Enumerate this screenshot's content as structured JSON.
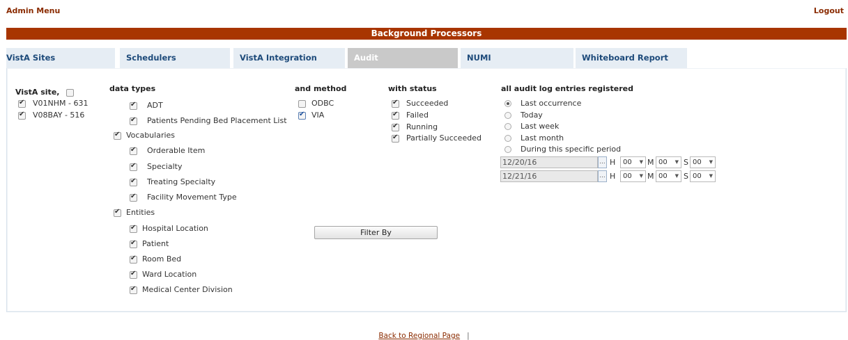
{
  "header": {
    "admin_menu": "Admin Menu",
    "logout": "Logout"
  },
  "title": "Background Processors",
  "tabs": [
    {
      "label": "VistA Sites"
    },
    {
      "label": "Schedulers"
    },
    {
      "label": "VistA Integration"
    },
    {
      "label": "Audit",
      "active": true
    },
    {
      "label": "NUMI"
    },
    {
      "label": "Whiteboard Report"
    }
  ],
  "sites": {
    "heading": "VistA site,",
    "all_checked": false,
    "items": [
      {
        "label": "V01NHM - 631",
        "checked": true
      },
      {
        "label": "V08BAY - 516",
        "checked": true
      }
    ]
  },
  "data_types": {
    "heading": "data types",
    "adt": {
      "label": "ADT",
      "checked": true
    },
    "pending": {
      "label": "Patients Pending Bed Placement List",
      "checked": true
    },
    "vocabularies": {
      "label": "Vocabularies",
      "checked": true,
      "items": [
        {
          "label": "Orderable Item",
          "checked": true
        },
        {
          "label": "Specialty",
          "checked": true
        },
        {
          "label": "Treating Specialty",
          "checked": true
        },
        {
          "label": "Facility Movement Type",
          "checked": true
        }
      ]
    },
    "entities": {
      "label": "Entities",
      "checked": true,
      "items": [
        {
          "label": "Hospital Location",
          "checked": true
        },
        {
          "label": "Patient",
          "checked": true
        },
        {
          "label": "Room Bed",
          "checked": true
        },
        {
          "label": "Ward Location",
          "checked": true
        },
        {
          "label": "Medical Center Division",
          "checked": true
        }
      ]
    }
  },
  "method": {
    "heading": "and method",
    "items": [
      {
        "label": "ODBC",
        "checked": false
      },
      {
        "label": "VIA",
        "checked": true
      }
    ]
  },
  "status": {
    "heading": "with status",
    "items": [
      {
        "label": "Succeeded",
        "checked": true
      },
      {
        "label": "Failed",
        "checked": true
      },
      {
        "label": "Running",
        "checked": true
      },
      {
        "label": "Partially Succeeded",
        "checked": true
      }
    ]
  },
  "period": {
    "heading": "all audit log entries registered",
    "options": [
      {
        "label": "Last occurrence",
        "selected": true
      },
      {
        "label": "Today",
        "selected": false
      },
      {
        "label": "Last week",
        "selected": false
      },
      {
        "label": "Last month",
        "selected": false
      },
      {
        "label": "During this specific period",
        "selected": false
      }
    ],
    "picker_label": "...",
    "from": {
      "date": "12/20/16",
      "h_label": "H",
      "h": "00",
      "m_label": "M",
      "m": "00",
      "s_label": "S",
      "s": "00"
    },
    "to": {
      "date": "12/21/16",
      "h_label": "H",
      "h": "00",
      "m_label": "M",
      "m": "00",
      "s_label": "S",
      "s": "00"
    }
  },
  "filter_button": "Filter By",
  "footer": {
    "back_link": "Back to Regional Page",
    "separator": "|"
  }
}
